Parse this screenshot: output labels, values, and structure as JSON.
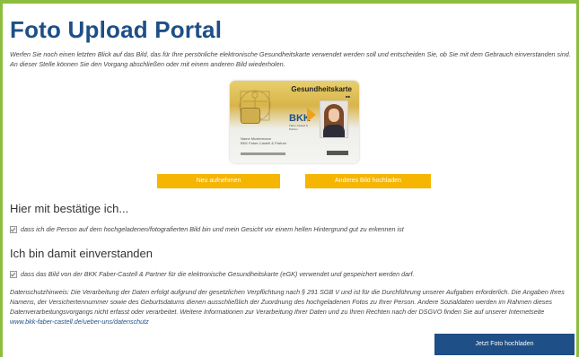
{
  "page": {
    "title": "Foto Upload Portal",
    "intro": "Werfen Sie noch einen letzten Blick auf das Bild, das für Ihre persönliche elektronische Gesundheitskarte verwendet werden soll und entscheiden Sie, ob Sie mit dem Gebrauch einverstanden sind. An dieser Stelle können Sie den Vorgang abschließen oder mit einem anderen Bild wiederholen."
  },
  "card": {
    "title": "Gesundheitskarte",
    "logo": "BKK",
    "logo_sub": "Faber-Castell & Partner",
    "holder_line1": "Name Mustermann",
    "holder_line2": "BKK Faber-Castell & Partner"
  },
  "buttons": {
    "retake_label": "Neu aufnehmen",
    "other_label": "Anderes Bild hochladen",
    "upload_label": "Jetzt Foto hochladen"
  },
  "confirm": {
    "heading": "Hier mit bestätige ich...",
    "checkbox_text": "dass ich die Person auf dem hochgeladenen/fotografierten Bild bin und mein Gesicht vor einem hellen Hintergrund gut zu erkennen ist"
  },
  "consent": {
    "heading": "Ich bin damit einverstanden",
    "checkbox_text": "dass das Bild von der BKK Faber-Castell & Partner für die elektronische Gesundheitskarte (eGK) verwendet und gespeichert werden darf."
  },
  "privacy": {
    "text": "Datenschutzhinweis: Die Verarbeitung der Daten erfolgt aufgrund der gesetzlichen Verpflichtung nach § 291 SGB V und ist für die Durchführung unserer Aufgaben erforderlich. Die Angaben Ihres Namens, der Versichertennummer sowie des Geburtsdatums dienen ausschließlich der Zuordnung des hochgeladenen Fotos zu Ihrer Person. Andere Sozialdaten werden im Rahmen dieses Datenverarbeitungsvorgangs nicht erfasst oder verarbeitet. Weitere Informationen zur Verarbeitung Ihrer Daten und zu Ihren Rechten nach der DSGVO finden Sie auf unserer Internetseite ",
    "link_text": "www.bkk-faber-castell.de/ueber-uns/datenschutz"
  },
  "colors": {
    "accent_green": "#8cbd3f",
    "brand_blue": "#1e4f86",
    "button_yellow": "#f5b500"
  },
  "icons": {
    "checkbox": "checkbox-checked-icon"
  }
}
